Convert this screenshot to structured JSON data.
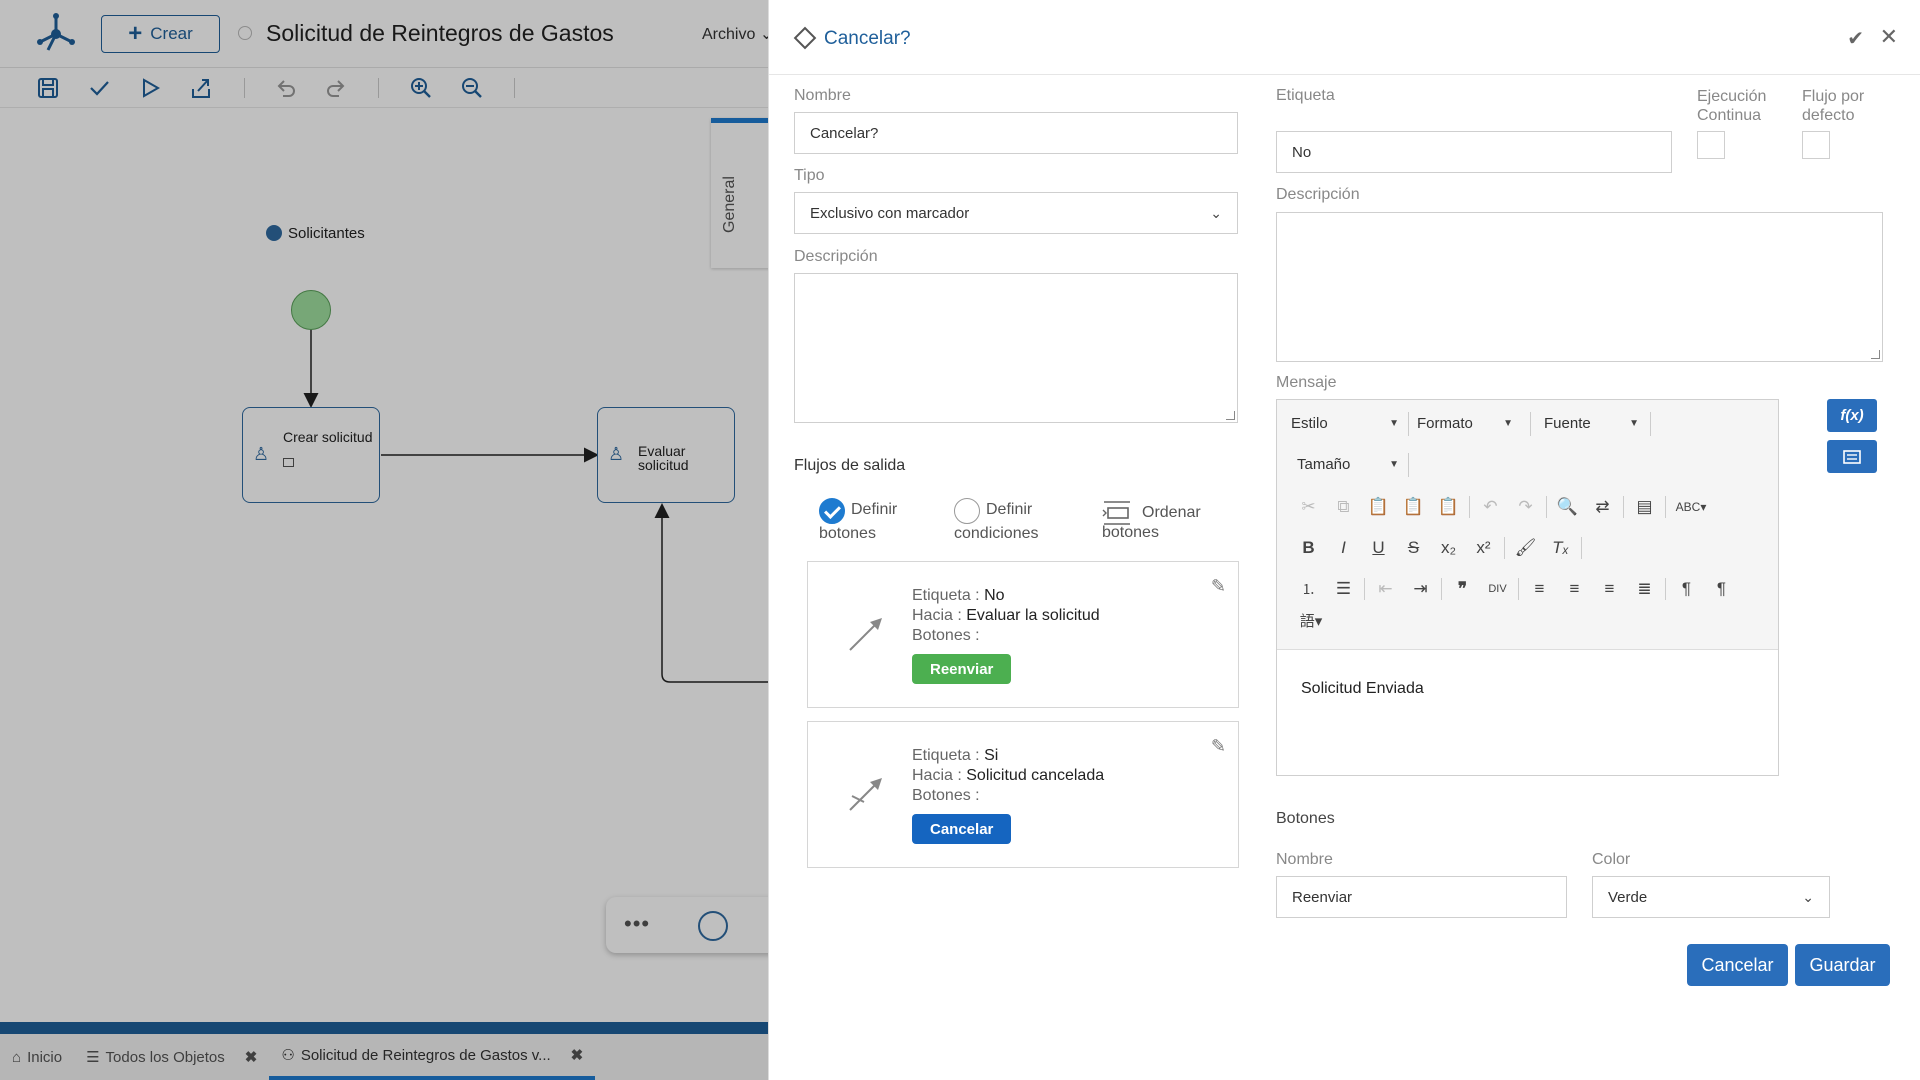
{
  "app": {
    "create_label": "Crear",
    "doc_title": "Solicitud de Reintegros de Gastos",
    "menu_archivo": "Archivo",
    "general_tab": "General",
    "lane_label": "Solicitantes",
    "node_crear": "Crear solicitud",
    "node_evaluar_1": "Evaluar",
    "node_evaluar_2": "solicitud",
    "bottom_tabs": [
      {
        "label": "Inicio",
        "icon": "home-icon"
      },
      {
        "label": "Todos los Objetos",
        "icon": "list-icon"
      },
      {
        "label": "Solicitud de Reintegros de Gastos v...",
        "icon": "process-icon"
      }
    ]
  },
  "panel": {
    "title": "Cancelar?",
    "nombre_label": "Nombre",
    "nombre_value": "Cancelar?",
    "tipo_label": "Tipo",
    "tipo_value": "Exclusivo con marcador",
    "descripcion_label": "Descripción",
    "flujos_title": "Flujos de salida",
    "radio_options": [
      {
        "line1": "Definir",
        "line2": "botones",
        "checked": true
      },
      {
        "line1": "Definir",
        "line2": "condiciones",
        "checked": false
      }
    ],
    "ordenar_line1": "Ordenar",
    "ordenar_line2": "botones",
    "flows": [
      {
        "etiqueta_key": "Etiqueta :",
        "etiqueta": "No",
        "hacia_key": "Hacia :",
        "hacia": "Evaluar la solicitud",
        "botones_key": "Botones :",
        "button": "Reenviar",
        "button_color": "#4caf50"
      },
      {
        "etiqueta_key": "Etiqueta :",
        "etiqueta": "Si",
        "hacia_key": "Hacia :",
        "hacia": "Solicitud cancelada",
        "botones_key": "Botones :",
        "button": "Cancelar",
        "button_color": "#1565c0"
      }
    ],
    "etiqueta_label": "Etiqueta",
    "etiqueta_value": "No",
    "ejecucion_line1": "Ejecución",
    "ejecucion_line2": "Continua",
    "flujo_line1": "Flujo por",
    "flujo_line2": "defecto",
    "descripcion2_label": "Descripción",
    "mensaje_label": "Mensaje",
    "editor": {
      "estilo": "Estilo",
      "formato": "Formato",
      "fuente": "Fuente",
      "tamano": "Tamaño",
      "content": "Solicitud Enviada"
    },
    "botones_title": "Botones",
    "btn_nombre_label": "Nombre",
    "btn_nombre_value": "Reenviar",
    "btn_color_label": "Color",
    "btn_color_value": "Verde",
    "cancel_label": "Cancelar",
    "save_label": "Guardar",
    "accent": "#1f5f9a"
  }
}
